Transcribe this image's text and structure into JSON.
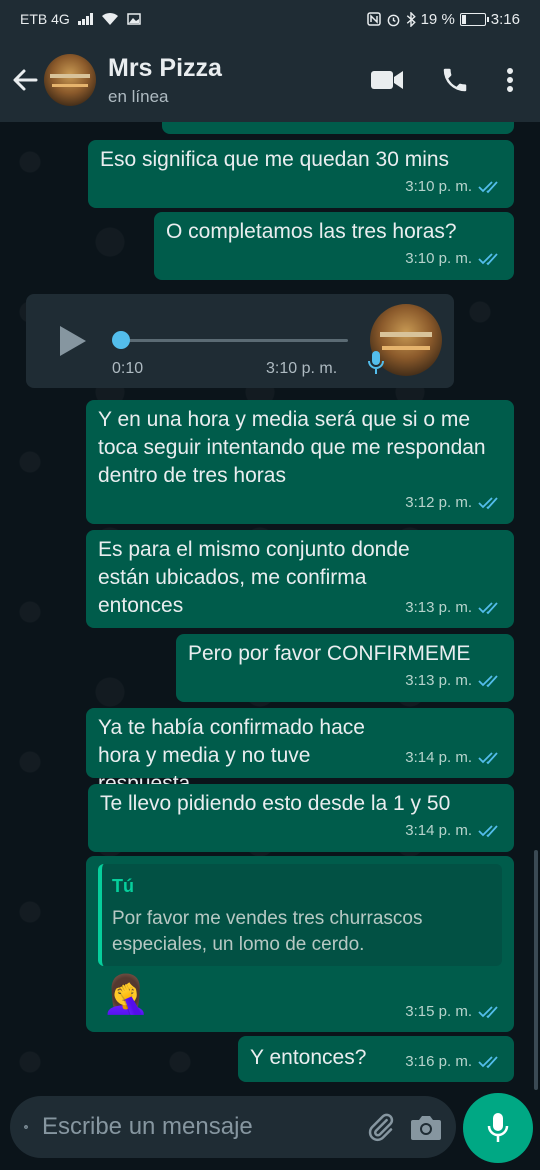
{
  "status_bar": {
    "carrier": "ETB 4G",
    "battery_percent": "19 %",
    "time": "3:16",
    "battery_level": 0.19
  },
  "header": {
    "title": "Mrs Pizza",
    "subtitle": "en línea"
  },
  "messages": [
    {
      "text": "Eso significa que me quedan 30 mins",
      "time": "3:10 p. m."
    },
    {
      "text": "O completamos las tres horas?",
      "time": "3:10 p. m."
    },
    {
      "type": "audio",
      "duration": "0:10",
      "time": "3:10 p. m.",
      "progress": 0
    },
    {
      "text": "Y en una hora y media será que si o me toca seguir intentando que me respondan dentro de tres horas",
      "time": "3:12 p. m."
    },
    {
      "text": "Es para el mismo conjunto donde están ubicados, me confirma entonces",
      "time": "3:13 p. m."
    },
    {
      "text": "Pero por favor CONFIRMEME",
      "time": "3:13 p. m."
    },
    {
      "text": "Ya te había confirmado hace hora y media y no tuve respuesta",
      "time": "3:14 p. m."
    },
    {
      "text": "Te llevo pidiendo esto desde la 1 y 50",
      "time": "3:14 p. m."
    },
    {
      "reply_author": "Tú",
      "reply_text": "Por favor me vendes tres churrascos especiales, un lomo de cerdo.",
      "text": "🤦‍♀️",
      "time": "3:15 p. m."
    },
    {
      "text": "Y entonces?",
      "time": "3:16 p. m."
    }
  ],
  "composer": {
    "placeholder": "Escribe un mensaje"
  },
  "colors": {
    "outgoing_bubble": "#005c4b",
    "incoming_bubble": "#1f2c34",
    "accent": "#00a884",
    "read_ticks": "#53bdeb",
    "header_bg": "#1f2c34"
  },
  "icons": [
    "back-arrow-icon",
    "video-call-icon",
    "phone-icon",
    "more-options-icon",
    "play-icon",
    "microphone-icon",
    "emoji-icon",
    "attach-icon",
    "camera-icon",
    "double-check-icon"
  ]
}
